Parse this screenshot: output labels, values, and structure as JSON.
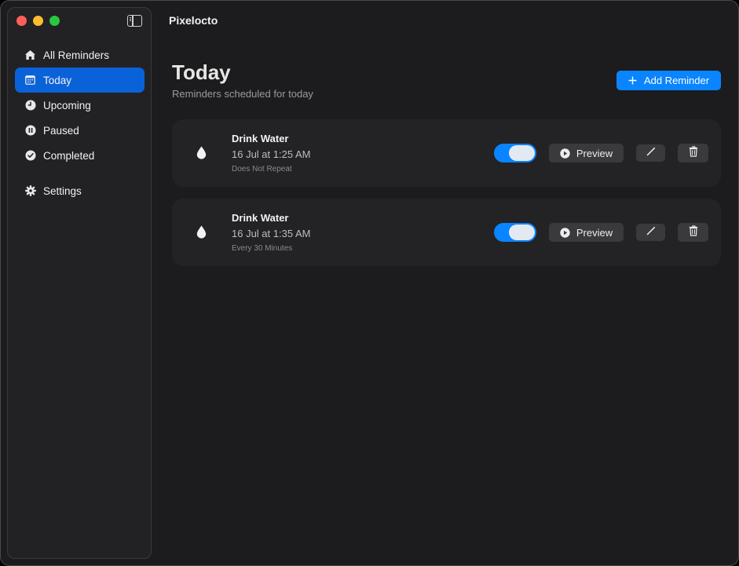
{
  "window": {
    "app_title": "Pixelocto"
  },
  "sidebar": {
    "items": [
      {
        "label": "All Reminders",
        "icon": "house-icon",
        "active": false
      },
      {
        "label": "Today",
        "icon": "calendar-icon",
        "active": true
      },
      {
        "label": "Upcoming",
        "icon": "clock-icon",
        "active": false
      },
      {
        "label": "Paused",
        "icon": "pause-circle-icon",
        "active": false
      },
      {
        "label": "Completed",
        "icon": "checkmark-circle-icon",
        "active": false
      }
    ],
    "settings": {
      "label": "Settings",
      "icon": "gear-icon"
    }
  },
  "main": {
    "title": "Today",
    "subtitle": "Reminders scheduled for today",
    "add_button_label": "Add Reminder"
  },
  "reminders": [
    {
      "title": "Drink Water",
      "time": "16 Jul at 1:25 AM",
      "repeat": "Does Not Repeat",
      "enabled": true,
      "icon": "water-drop-icon",
      "preview_label": "Preview"
    },
    {
      "title": "Drink Water",
      "time": "16 Jul at 1:35 AM",
      "repeat": "Every 30 Minutes",
      "enabled": true,
      "icon": "water-drop-icon",
      "preview_label": "Preview"
    }
  ],
  "colors": {
    "accent": "#0a84ff",
    "sidebar_active": "#0a62d8",
    "background": "#1c1c1e",
    "card": "#232325"
  }
}
